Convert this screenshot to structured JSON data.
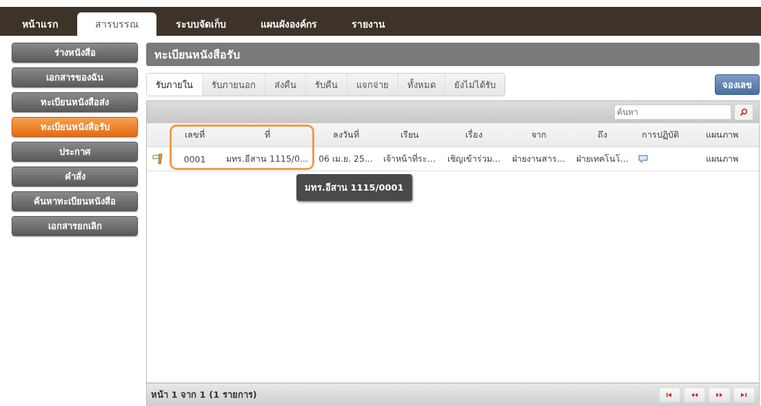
{
  "nav_tabs": [
    {
      "label": "หน้าแรก",
      "selected": false
    },
    {
      "label": "สารบรรณ",
      "selected": true
    },
    {
      "label": "ระบบจัดเก็บ",
      "selected": false
    },
    {
      "label": "แผนผังองค์กร",
      "selected": false
    },
    {
      "label": "รายงาน",
      "selected": false
    }
  ],
  "sidebar": {
    "items": [
      {
        "label": "ร่างหนังสือ",
        "selected": false
      },
      {
        "label": "เอกสารของฉัน",
        "selected": false
      },
      {
        "label": "ทะเบียนหนังสือส่ง",
        "selected": false
      },
      {
        "label": "ทะเบียนหนังสือรับ",
        "selected": true
      },
      {
        "label": "ประกาศ",
        "selected": false
      },
      {
        "label": "คำสั่ง",
        "selected": false
      },
      {
        "label": "ค้นหาทะเบียนหนังสือ",
        "selected": false
      },
      {
        "label": "เอกสารยกเลิก",
        "selected": false
      }
    ]
  },
  "panel": {
    "title": "ทะเบียนหนังสือรับ",
    "tabs": [
      {
        "label": "รับภายใน",
        "selected": true
      },
      {
        "label": "รับภายนอก",
        "selected": false
      },
      {
        "label": "ส่งคืน",
        "selected": false
      },
      {
        "label": "รับคืน",
        "selected": false
      },
      {
        "label": "แจกจ่าย",
        "selected": false
      },
      {
        "label": "ทั้งหมด",
        "selected": false
      },
      {
        "label": "ยังไม่ได้รับ",
        "selected": false
      }
    ],
    "reserve_button": "จองเลข",
    "search": {
      "placeholder": "ค้นหา"
    },
    "table": {
      "columns": [
        "เลขที่",
        "ที่",
        "ลงวันที่",
        "เรียน",
        "เรื่อง",
        "จาก",
        "ถึง",
        "การปฏิบัติ",
        "แผนภาพ"
      ],
      "rows": [
        {
          "number": "0001",
          "ref": "มทร.อีสาน 1115/0...",
          "date": "06 เม.ย. 25...",
          "to": "เจ้าหน้าที่ระ...",
          "subject": "เชิญเข้าร่วม...",
          "from": "ฝ่ายงานสาร...",
          "recipient": "ฝ่ายเทคโนโ...",
          "diagram": "แผนภาพ"
        }
      ]
    },
    "tooltip": "มทร.อีสาน 1115/0001",
    "pager": {
      "text": "หน้า 1 จาก 1 (1 รายการ)"
    }
  }
}
